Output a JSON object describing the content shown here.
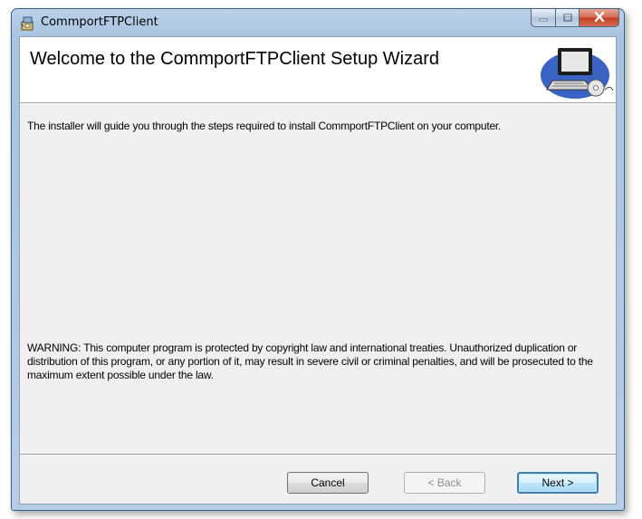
{
  "window": {
    "title": "CommportFTPClient",
    "app_icon": "installer-package-icon",
    "caption_buttons": [
      "minimize-icon",
      "maximize-icon",
      "close-icon"
    ]
  },
  "banner": {
    "title": "Welcome to the CommportFTPClient Setup Wizard",
    "image": "computer-with-disc-icon"
  },
  "body": {
    "intro": "The installer will guide you through the steps required to install CommportFTPClient on your computer.",
    "warning": "WARNING: This computer program is protected by copyright law and international treaties. Unauthorized duplication or distribution of this program, or any portion of it, may result in severe civil or criminal penalties, and will be prosecuted to the maximum extent possible under the law."
  },
  "buttons": {
    "cancel": "Cancel",
    "back": "< Back",
    "next": "Next >"
  },
  "colors": {
    "title_bar": "#a9c3e0",
    "close_button": "#c13f24",
    "client_bg": "#f0f0f0",
    "default_button_border": "#3c7fb1"
  }
}
